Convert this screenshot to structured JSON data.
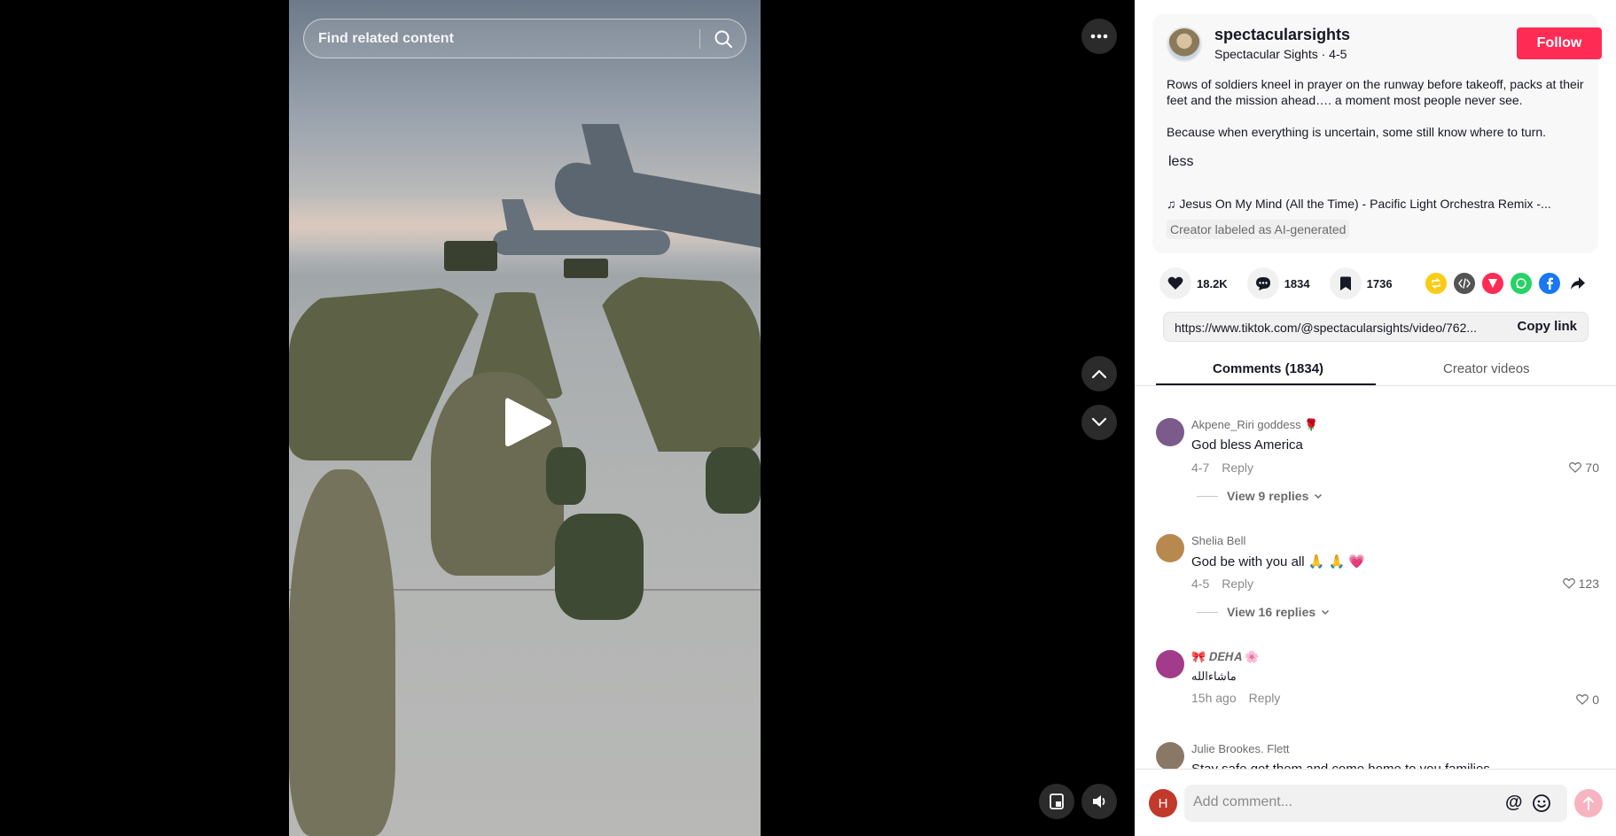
{
  "search": {
    "placeholder": "Find related content"
  },
  "author": {
    "username": "spectacularsights",
    "display_line": "Spectacular Sights · 4-5",
    "follow_label": "Follow"
  },
  "description": {
    "paragraph1": "Rows of soldiers kneel in prayer on the runway before takeoff, packs at their feet and the mission ahead…. a moment most people never see.",
    "paragraph2": "Because when everything is uncertain, some still know where to turn.",
    "less_label": "less"
  },
  "music": {
    "title": "♫  Jesus On My Mind (All the Time) - Pacific Light Orchestra Remix -..."
  },
  "ai_label": "Creator labeled as AI-generated",
  "stats": {
    "likes": "18.2K",
    "comments": "1834",
    "saves": "1736"
  },
  "share_icons": [
    "repost-icon",
    "embed-icon",
    "send-to-friends-icon",
    "whatsapp-icon",
    "facebook-icon",
    "share-icon"
  ],
  "link": {
    "url": "https://www.tiktok.com/@spectacularsights/video/762...",
    "copy_label": "Copy link"
  },
  "tabs": [
    {
      "label": "Comments (1834)",
      "active": true
    },
    {
      "label": "Creator videos",
      "active": false
    }
  ],
  "comments": [
    {
      "name": "Akpene_Riri goddess 🌹",
      "text": "God bless America",
      "time": "4-7",
      "reply_label": "Reply",
      "likes": "70",
      "replies_label": "View 9 replies",
      "avatar_color": "#7b5a8c"
    },
    {
      "name": "Shelia Bell",
      "text": "God be with you all 🙏 🙏 💗",
      "time": "4-5",
      "reply_label": "Reply",
      "likes": "123",
      "replies_label": "View 16 replies",
      "avatar_color": "#b8894f"
    },
    {
      "name": "🎀 𝑫𝑬𝑯𝑨 🌸",
      "text": "ماشاءالله",
      "time": "15h ago",
      "reply_label": "Reply",
      "likes": "0",
      "replies_label": "",
      "avatar_color": "#a23b8a"
    },
    {
      "name": "Julie Brookes. Flett",
      "text": "Stay safe get them and come home to you families",
      "time": "",
      "reply_label": "",
      "likes": "",
      "replies_label": "",
      "avatar_color": "#8a7866"
    }
  ],
  "composer": {
    "avatar_letter": "H",
    "placeholder": "Add comment...",
    "mention_symbol": "@"
  },
  "colors": {
    "accent": "#fe2c55",
    "panel_bg": "#ffffff",
    "stage_bg": "#000000"
  }
}
